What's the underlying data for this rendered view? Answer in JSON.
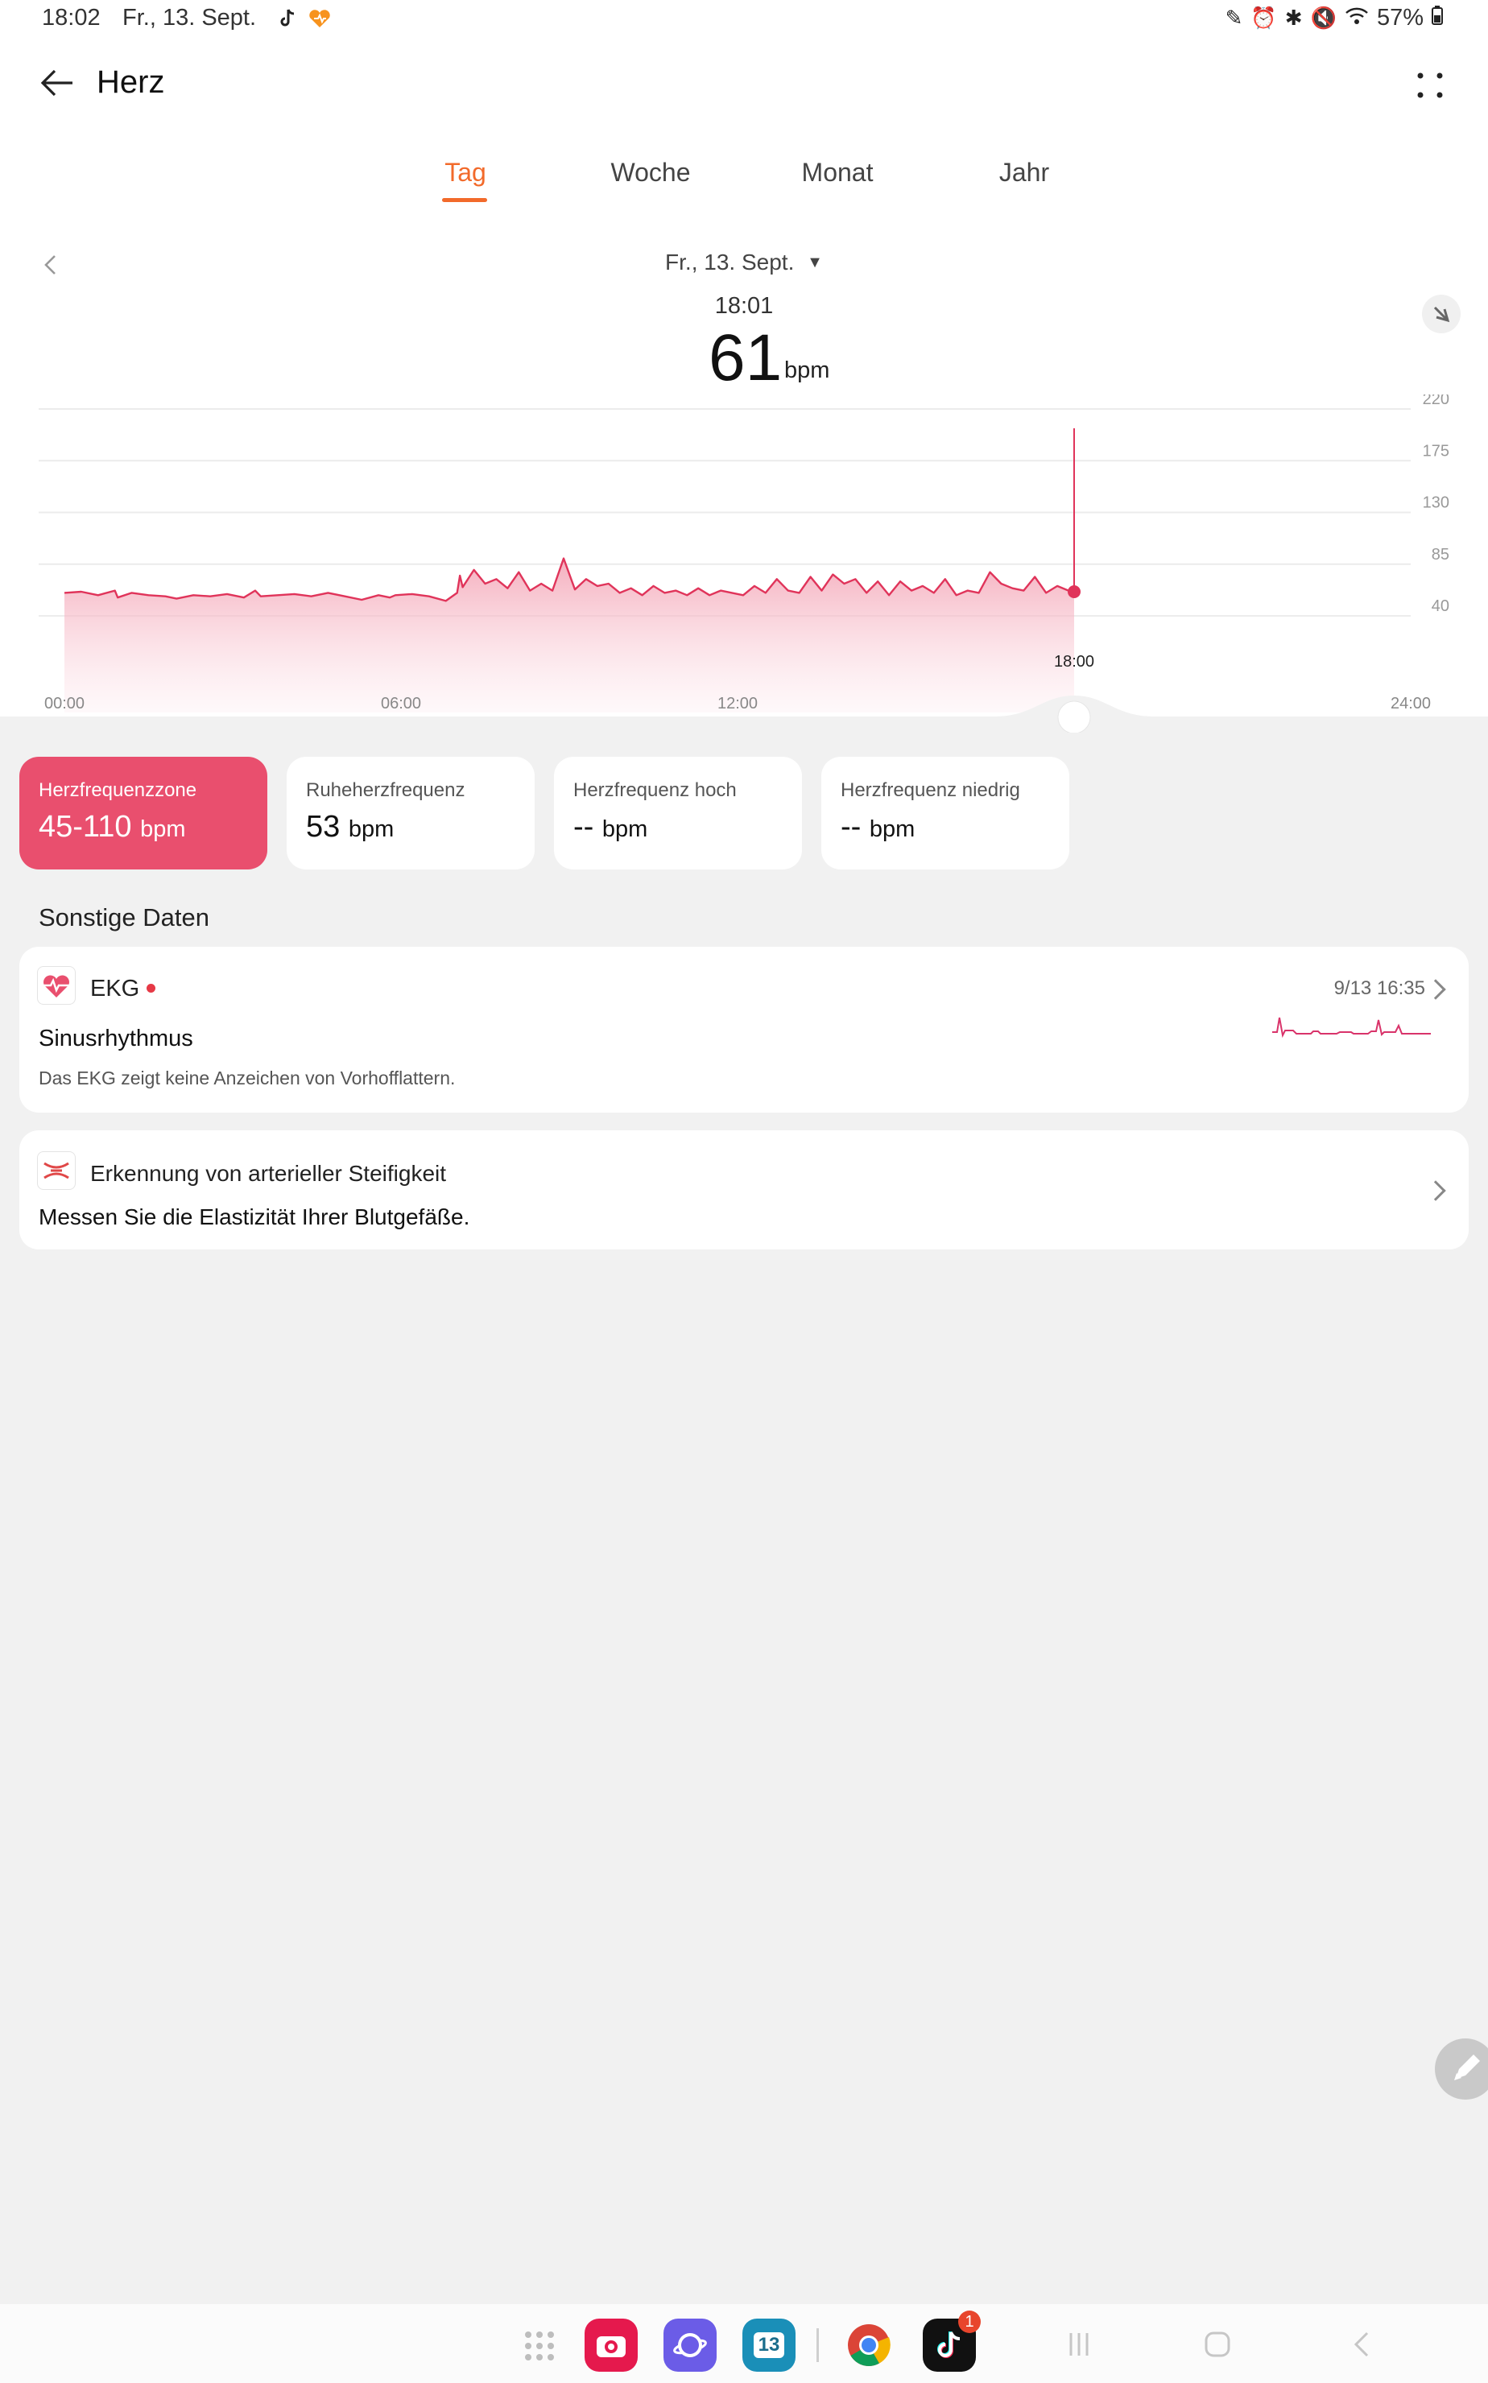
{
  "status_bar": {
    "time": "18:02",
    "date": "Fr., 13. Sept.",
    "battery": "57%"
  },
  "header": {
    "title": "Herz"
  },
  "tabs": [
    {
      "label": "Tag",
      "active": true
    },
    {
      "label": "Woche",
      "active": false
    },
    {
      "label": "Monat",
      "active": false
    },
    {
      "label": "Jahr",
      "active": false
    }
  ],
  "selection": {
    "date": "Fr., 13. Sept.",
    "time": "18:01",
    "value": "61",
    "unit": "bpm"
  },
  "chart_data": {
    "type": "area",
    "x_ticks": [
      "00:00",
      "06:00",
      "12:00",
      "24:00"
    ],
    "y_ticks": [
      "220",
      "175",
      "130",
      "85",
      "40"
    ],
    "ylim": [
      40,
      220
    ],
    "xlim_hours": [
      0,
      24
    ],
    "marker_label": "18:00",
    "marker_hour": 18.0,
    "marker_value": 61,
    "series": [
      {
        "x": [
          0.0,
          0.3,
          0.6,
          0.9,
          0.95,
          1.2,
          1.5,
          1.8,
          2.0,
          2.3,
          2.6,
          2.9,
          3.2,
          3.4,
          3.5,
          3.8,
          4.1,
          4.4,
          4.7,
          5.0,
          5.3,
          5.6,
          5.8,
          5.9,
          6.2,
          6.5,
          6.8,
          7.0,
          7.05,
          7.1,
          7.3,
          7.5,
          7.7,
          7.9,
          8.1,
          8.3,
          8.5,
          8.7,
          8.9,
          9.1,
          9.3,
          9.5,
          9.7,
          9.9,
          10.1,
          10.3,
          10.5,
          10.7,
          10.9,
          11.1,
          11.3,
          11.5,
          11.7,
          11.9,
          12.1,
          12.3,
          12.5,
          12.7,
          12.9,
          13.1,
          13.3,
          13.5,
          13.7,
          13.9,
          14.1,
          14.3,
          14.5,
          14.7,
          14.9,
          15.1,
          15.3,
          15.5,
          15.7,
          15.9,
          16.1,
          16.3,
          16.5,
          16.7,
          16.9,
          17.1,
          17.3,
          17.5,
          17.7,
          17.9,
          18.0
        ],
        "y": [
          60,
          61,
          58,
          62,
          56,
          60,
          58,
          57,
          55,
          58,
          57,
          59,
          56,
          62,
          57,
          58,
          59,
          57,
          60,
          57,
          54,
          58,
          56,
          58,
          59,
          57,
          53,
          60,
          75,
          65,
          80,
          68,
          72,
          64,
          78,
          62,
          68,
          62,
          90,
          63,
          72,
          66,
          68,
          60,
          64,
          58,
          66,
          60,
          62,
          58,
          64,
          58,
          62,
          60,
          58,
          66,
          60,
          72,
          62,
          60,
          74,
          62,
          76,
          68,
          72,
          60,
          70,
          58,
          70,
          62,
          66,
          60,
          72,
          58,
          62,
          60,
          78,
          68,
          64,
          62,
          74,
          60,
          66,
          62,
          61
        ]
      }
    ]
  },
  "stats": [
    {
      "label": "Herzfrequenzzone",
      "value": "45-110",
      "unit": "bpm",
      "highlight": true
    },
    {
      "label": "Ruheherzfrequenz",
      "value": "53",
      "unit": "bpm",
      "highlight": false
    },
    {
      "label": "Herzfrequenz hoch",
      "value": "--",
      "unit": "bpm",
      "highlight": false
    },
    {
      "label": "Herzfrequenz niedrig",
      "value": "--",
      "unit": "bpm",
      "highlight": false
    }
  ],
  "section_title": "Sonstige Daten",
  "ekg": {
    "title": "EKG",
    "timestamp": "9/13 16:35",
    "result": "Sinusrhythmus",
    "note": "Das EKG zeigt keine Anzeichen von Vorhofflattern."
  },
  "stiffness": {
    "title": "Erkennung von arterieller Steifigkeit",
    "subtitle": "Messen Sie die Elastizität Ihrer Blutgefäße."
  },
  "dock": {
    "calendar_day": "13",
    "tiktok_badge": "1"
  },
  "colors": {
    "accent": "#f26a2b",
    "heart": "#e94f6e",
    "chart_line": "#e0345a"
  }
}
